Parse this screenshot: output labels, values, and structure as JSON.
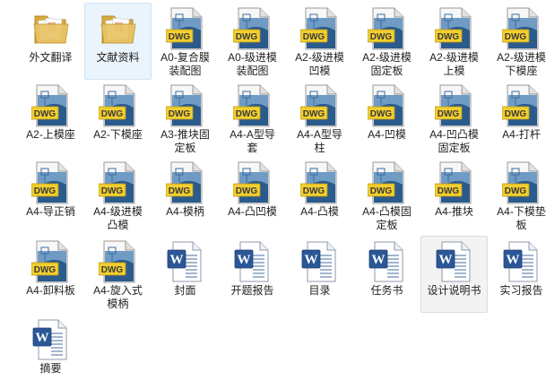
{
  "files": [
    {
      "name": "外文翻译",
      "type": "folder"
    },
    {
      "name": "文献资料",
      "type": "folder"
    },
    {
      "name": "A0-复合膜\n装配图",
      "type": "dwg"
    },
    {
      "name": "A0-级进模\n装配图",
      "type": "dwg"
    },
    {
      "name": "A2-级进模\n凹模",
      "type": "dwg"
    },
    {
      "name": "A2-级进模\n固定板",
      "type": "dwg"
    },
    {
      "name": "A2-级进模\n上模",
      "type": "dwg"
    },
    {
      "name": "A2-级进模\n下模座",
      "type": "dwg"
    },
    {
      "name": "A2-上模座",
      "type": "dwg"
    },
    {
      "name": "A2-下模座",
      "type": "dwg"
    },
    {
      "name": "A3-推块固\n定板",
      "type": "dwg"
    },
    {
      "name": "A4-A型导\n套",
      "type": "dwg"
    },
    {
      "name": "A4-A型导\n柱",
      "type": "dwg"
    },
    {
      "name": "A4-凹模",
      "type": "dwg"
    },
    {
      "name": "A4-凹凸模\n固定板",
      "type": "dwg"
    },
    {
      "name": "A4-打杆",
      "type": "dwg"
    },
    {
      "name": "A4-导正销",
      "type": "dwg"
    },
    {
      "name": "A4-级进模\n凸模",
      "type": "dwg"
    },
    {
      "name": "A4-模柄",
      "type": "dwg"
    },
    {
      "name": "A4-凸凹模",
      "type": "dwg"
    },
    {
      "name": "A4-凸模",
      "type": "dwg"
    },
    {
      "name": "A4-凸模固\n定板",
      "type": "dwg"
    },
    {
      "name": "A4-推块",
      "type": "dwg"
    },
    {
      "name": "A4-下模垫\n板",
      "type": "dwg"
    },
    {
      "name": "A4-卸料板",
      "type": "dwg"
    },
    {
      "name": "A4-旋入式\n模柄",
      "type": "dwg"
    },
    {
      "name": "封面",
      "type": "word"
    },
    {
      "name": "开题报告",
      "type": "word"
    },
    {
      "name": "目录",
      "type": "word"
    },
    {
      "name": "任务书",
      "type": "word"
    },
    {
      "name": "设计说明书",
      "type": "word"
    },
    {
      "name": "实习报告",
      "type": "word"
    },
    {
      "name": "摘要",
      "type": "word"
    }
  ],
  "selected_item": "文献资料",
  "hovered_item": "设计说明书",
  "dwg_badge_text": "DWG",
  "word_badge_text": "W",
  "colors": {
    "folder": "#e9c466",
    "dwg_body": "#2a5b8c",
    "dwg_badge": "#f2cf2e",
    "word_blue": "#2b5797",
    "selection": "#eaf4fd"
  }
}
